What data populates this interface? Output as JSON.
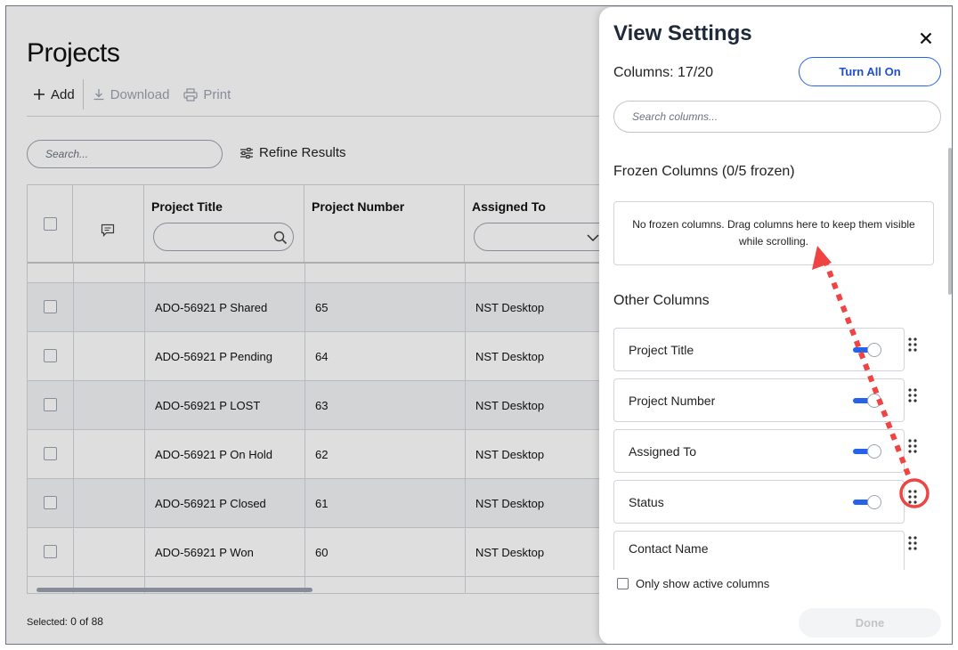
{
  "app": {
    "page_title": "Projects",
    "toolbar": {
      "add_label": "Add",
      "download_label": "Download",
      "print_label": "Print"
    },
    "search": {
      "placeholder": "Search..."
    },
    "refine_label": "Refine Results",
    "table": {
      "columns": [
        "Project Title",
        "Project Number",
        "Assigned To"
      ],
      "rows": [
        {
          "title": "ADO-56921 P Shared",
          "number": "65",
          "assigned": "NST Desktop"
        },
        {
          "title": "ADO-56921 P Pending",
          "number": "64",
          "assigned": "NST Desktop"
        },
        {
          "title": "ADO-56921 P LOST",
          "number": "63",
          "assigned": "NST Desktop"
        },
        {
          "title": "ADO-56921 P On Hold",
          "number": "62",
          "assigned": "NST Desktop"
        },
        {
          "title": "ADO-56921 P Closed",
          "number": "61",
          "assigned": "NST Desktop"
        },
        {
          "title": "ADO-56921 P Won",
          "number": "60",
          "assigned": "NST Desktop"
        }
      ]
    },
    "selected": {
      "label": "Selected:",
      "value": "0 of 88"
    }
  },
  "panel": {
    "title": "View Settings",
    "columns_count": "Columns: 17/20",
    "turn_all_on_label": "Turn All On",
    "search_placeholder": "Search columns...",
    "frozen_heading": "Frozen Columns (0/5 frozen)",
    "frozen_empty_text": "No frozen columns. Drag columns here to keep them visible while scrolling.",
    "other_heading": "Other Columns",
    "columns": [
      {
        "label": "Project Title",
        "on": true
      },
      {
        "label": "Project Number",
        "on": true
      },
      {
        "label": "Assigned To",
        "on": true
      },
      {
        "label": "Status",
        "on": true
      },
      {
        "label": "Contact Name",
        "on": null
      }
    ],
    "only_active_label": "Only show active columns",
    "done_label": "Done"
  },
  "colors": {
    "accent": "#2563eb",
    "annotation": "#ef4444"
  }
}
